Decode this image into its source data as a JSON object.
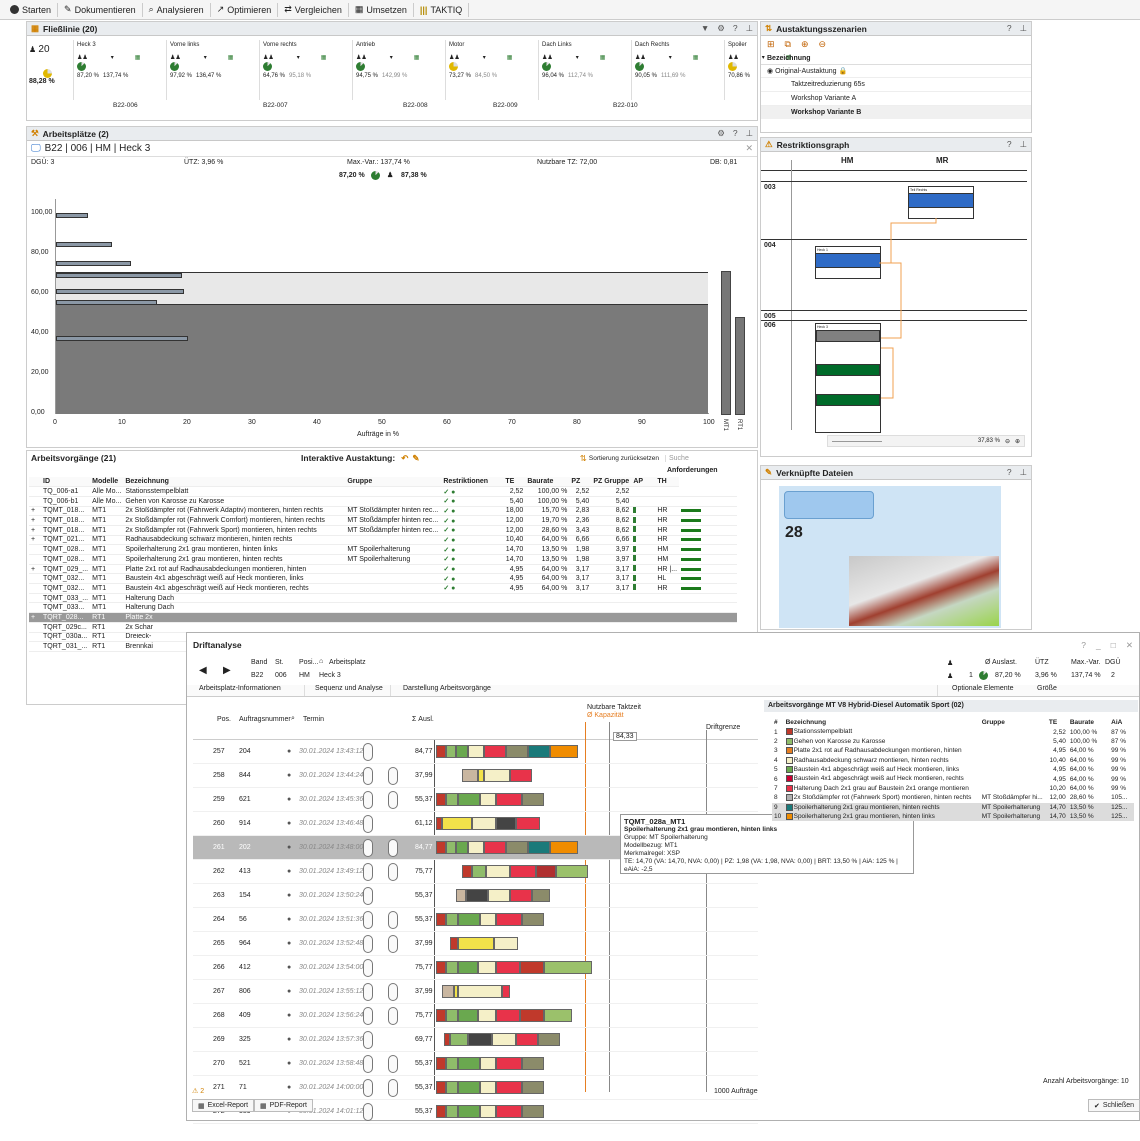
{
  "toolbar": [
    "Starten",
    "Dokumentieren",
    "Analysieren",
    "Optimieren",
    "Vergleichen",
    "Umsetzen",
    "TAKTIQ"
  ],
  "flow": {
    "title": "Fließlinie (20)",
    "count": "20",
    "total": "88,28 %",
    "stations": [
      {
        "name": "Heck 3",
        "a": "87,20 %",
        "b": "137,74 %"
      },
      {
        "name": "Vorne links",
        "a": "97,92 %",
        "b": "136,47 %"
      },
      {
        "name": "Vorne rechts",
        "a": "64,76 %",
        "b": "95,18 %"
      },
      {
        "name": "Antrieb",
        "a": "94,75 %",
        "b": "142,99 %"
      },
      {
        "name": "Motor",
        "a": "73,27 %",
        "b": "84,50 %"
      },
      {
        "name": "Dach Links",
        "a": "96,04 %",
        "b": "112,74 %"
      },
      {
        "name": "Dach Rechts",
        "a": "90,05 %",
        "b": "111,69 %"
      },
      {
        "name": "Spoiler",
        "a": "70,86 %",
        "b": ""
      }
    ],
    "bands": [
      "B22-006",
      "B22-007",
      "B22-008",
      "B22-009",
      "B22-010"
    ]
  },
  "scen": {
    "title": "Austaktungsszenarien",
    "col": "Bezeichnung",
    "items": [
      "Original-Austaktung",
      "Taktzeitreduzierung 65s",
      "Workshop Variante A",
      "Workshop Variante B"
    ]
  },
  "ap": {
    "title": "Arbeitsplätze (2)",
    "name": "B22 | 006 | HM | Heck 3",
    "dgu": "DGÜ: 3",
    "utz": "ÜTZ: 3,96 %",
    "max": "Max.-Var.: 137,74 %",
    "ntz": "Nutzbare TZ: 72,00",
    "db": "DB: 0,81",
    "s1": "87,20 %",
    "s2": "87,38 %",
    "yt": [
      "100,00",
      "80,00",
      "60,00",
      "40,00",
      "20,00",
      "0,00"
    ],
    "xt": [
      "0",
      "10",
      "20",
      "30",
      "40",
      "50",
      "60",
      "70",
      "80",
      "90",
      "100"
    ],
    "xl": "Aufträge in %",
    "vl": [
      "MT1",
      "RT1"
    ]
  },
  "restr": {
    "title": "Restriktionsgraph",
    "c1": "HM",
    "c2": "MR",
    "rows": [
      "003",
      "004",
      "005",
      "006"
    ],
    "lbls": [
      "Teil Rechts",
      "Heck 1",
      "Heck 3"
    ],
    "zoom": "37,83 %"
  },
  "files": {
    "title": "Verknüpfte Dateien",
    "num": "28"
  },
  "av": {
    "title": "Arbeitsvorgänge (21)",
    "ia": "Interaktive Austaktung:",
    "sort": "Sortierung zurücksetzen",
    "search": "Suche",
    "anf": "Anforderungen",
    "cols": [
      "ID",
      "Modelle",
      "Bezeichnung",
      "Gruppe",
      "Restriktionen",
      "TE",
      "Baurate",
      "PZ",
      "PZ Gruppe",
      "AP",
      "TH"
    ],
    "rows": [
      [
        "",
        "TQ_006-a1",
        "Alle Mo...",
        "Stationsstempelblatt",
        "",
        "2,52",
        "100,00 %",
        "2,52",
        "2,52",
        ""
      ],
      [
        "",
        "TQ_006-b1",
        "Alle Mo...",
        "Gehen von Karosse zu Karosse",
        "",
        "5,40",
        "100,00 %",
        "5,40",
        "5,40",
        ""
      ],
      [
        "+",
        "TQMT_018...",
        "MT1",
        "2x Stoßdämpfer rot (Fahrwerk Adaptiv) montieren, hinten rechts",
        "MT Stoßdämpfer hinten rec...",
        "18,00",
        "15,70 %",
        "2,83",
        "8,62",
        "HR"
      ],
      [
        "+",
        "TQMT_018...",
        "MT1",
        "2x Stoßdämpfer rot (Fahrwerk Comfort) montieren, hinten rechts",
        "MT Stoßdämpfer hinten rec...",
        "12,00",
        "19,70 %",
        "2,36",
        "8,62",
        "HR"
      ],
      [
        "+",
        "TQMT_018...",
        "MT1",
        "2x Stoßdämpfer rot (Fahrwerk Sport) montieren, hinten rechts",
        "MT Stoßdämpfer hinten rec...",
        "12,00",
        "28,60 %",
        "3,43",
        "8,62",
        "HR"
      ],
      [
        "+",
        "TQMT_021...",
        "MT1",
        "Radhausabdeckung schwarz montieren, hinten rechts",
        "",
        "10,40",
        "64,00 %",
        "6,66",
        "6,66",
        "HR"
      ],
      [
        "",
        "TQMT_028...",
        "MT1",
        "Spoilerhalterung 2x1 grau montieren, hinten links",
        "MT Spoilerhalterung",
        "14,70",
        "13,50 %",
        "1,98",
        "3,97",
        "HM"
      ],
      [
        "",
        "TQMT_028...",
        "MT1",
        "Spoilerhalterung 2x1 grau montieren, hinten rechts",
        "MT Spoilerhalterung",
        "14,70",
        "13,50 %",
        "1,98",
        "3,97",
        "HM"
      ],
      [
        "+",
        "TQMT_029_...",
        "MT1",
        "Platte 2x1 rot auf Radhausabdeckungen montieren, hinten",
        "",
        "4,95",
        "64,00 %",
        "3,17",
        "3,17",
        "HR |..."
      ],
      [
        "",
        "TQMT_032...",
        "MT1",
        "Baustein 4x1 abgeschrägt weiß auf Heck montieren, links",
        "",
        "4,95",
        "64,00 %",
        "3,17",
        "3,17",
        "HL"
      ],
      [
        "",
        "TQMT_032...",
        "MT1",
        "Baustein 4x1 abgeschrägt weiß auf Heck montieren, rechts",
        "",
        "4,95",
        "64,00 %",
        "3,17",
        "3,17",
        "HR"
      ],
      [
        "",
        "TQMT_033_...",
        "MT1",
        "Halterung Dach",
        "",
        "",
        "",
        "",
        "",
        ""
      ],
      [
        "",
        "TQMT_033...",
        "MT1",
        "Halterung Dach",
        "",
        "",
        "",
        "",
        "",
        ""
      ],
      [
        "+",
        "TQRT_028...",
        "RT1",
        "Platte 2x",
        "",
        "",
        "",
        "",
        "",
        ""
      ],
      [
        "",
        "TQRT_029c...",
        "RT1",
        "2x Schar",
        "",
        "",
        "",
        "",
        "",
        ""
      ],
      [
        "",
        "TQRT_030a...",
        "RT1",
        "Dreieck-",
        "",
        "",
        "",
        "",
        "",
        ""
      ],
      [
        "",
        "TQRT_031_...",
        "RT1",
        "Brennkai",
        "",
        "",
        "",
        "",
        "",
        ""
      ]
    ]
  },
  "drift": {
    "title": "Driftanalyse",
    "band": "Band",
    "st": "St.",
    "posi": "Posi...",
    "arbeitsplatz": "Arbeitsplatz",
    "bv": "B22",
    "sv": "006",
    "pv": "HM",
    "av": "Heck 3",
    "h_ausl": "Ø Auslast.",
    "h_utz": "ÜTZ",
    "h_max": "Max.-Var.",
    "h_dgu": "DGÜ",
    "v_n": "1",
    "v_ausl": "87,20 %",
    "v_utz": "3,96 %",
    "v_max": "137,74 %",
    "v_dgu": "2",
    "tabs": [
      "Arbeitsplatz-Informationen",
      "Sequenz und Analyse",
      "Darstellung Arbeitsvorgänge",
      "Optionale Elemente",
      "Größe"
    ],
    "ch": [
      "Pos.",
      "Auftragsnummer",
      "Termin",
      "Σ Ausl."
    ],
    "ntz": "Nutzbare Taktzeit",
    "kap": "Ø Kapazität",
    "drg": "Driftgrenze",
    "kv": "84,33",
    "rows": [
      [
        "257",
        "204",
        "30.01.2024 13:43:12",
        "84,77"
      ],
      [
        "258",
        "844",
        "30.01.2024 13:44:24",
        "37,99"
      ],
      [
        "259",
        "621",
        "30.01.2024 13:45:36",
        "55,37"
      ],
      [
        "260",
        "914",
        "30.01.2024 13:46:48",
        "61,12"
      ],
      [
        "261",
        "202",
        "30.01.2024 13:48:00",
        "84,77"
      ],
      [
        "262",
        "413",
        "30.01.2024 13:49:12",
        "75,77"
      ],
      [
        "263",
        "154",
        "30.01.2024 13:50:24",
        "55,37"
      ],
      [
        "264",
        "56",
        "30.01.2024 13:51:36",
        "55,37"
      ],
      [
        "265",
        "964",
        "30.01.2024 13:52:48",
        "37,99"
      ],
      [
        "266",
        "412",
        "30.01.2024 13:54:00",
        "75,77"
      ],
      [
        "267",
        "806",
        "30.01.2024 13:55:12",
        "37,99"
      ],
      [
        "268",
        "409",
        "30.01.2024 13:56:24",
        "75,77"
      ],
      [
        "269",
        "325",
        "30.01.2024 13:57:36",
        "69,77"
      ],
      [
        "270",
        "521",
        "30.01.2024 13:58:48",
        "55,37"
      ],
      [
        "271",
        "71",
        "30.01.2024 14:00:00",
        "55,37"
      ],
      [
        "272",
        "589",
        "30.01.2024 14:01:12",
        "55,37"
      ]
    ],
    "tip": [
      "TQMT_028a_MT1",
      "Spoilerhalterung 2x1 grau montieren, hinten links",
      "Gruppe: MT Spoilerhalterung",
      "Modellbezug: MT1",
      "Merkmalregel: XSP",
      "TE: 14,70 (VA: 14,70, NVA: 0,00) | PZ: 1,98 (VA: 1,98, NVA: 0,00) | BRT: 13,50 % | AiA: 125 % | eAiA: -2,5"
    ],
    "foot": "1000 Aufträge",
    "warn": "2",
    "excel": "Excel-Report",
    "pdf": "PDF-Report",
    "close": "Schließen"
  },
  "rp": {
    "title": "Arbeitsvorgänge MT V8 Hybrid-Diesel Automatik Sport (02)",
    "cols": [
      "#",
      "Bezeichnung",
      "Gruppe",
      "TE",
      "Baurate",
      "AiA"
    ],
    "rows": [
      [
        "1",
        "Stationsstempelblatt",
        "",
        "2,52",
        "100,00 %",
        "87 %",
        "#c0392b"
      ],
      [
        "2",
        "Gehen von Karosse zu Karosse",
        "",
        "5,40",
        "100,00 %",
        "87 %",
        "#8fbc6a"
      ],
      [
        "3",
        "Platte 2x1 rot auf Radhausabdeckungen montieren, hinten",
        "",
        "4,95",
        "64,00 %",
        "99 %",
        "#e67e22"
      ],
      [
        "4",
        "Radhausabdeckung schwarz montieren, hinten rechts",
        "",
        "10,40",
        "64,00 %",
        "99 %",
        "#f5f0c8"
      ],
      [
        "5",
        "Baustein 4x1 abgeschrägt weiß auf Heck montieren, links",
        "",
        "4,95",
        "64,00 %",
        "99 %",
        "#6aa84f"
      ],
      [
        "6",
        "Baustein 4x1 abgeschrägt weiß auf Heck montieren, rechts",
        "",
        "4,95",
        "64,00 %",
        "99 %",
        "#cc0033"
      ],
      [
        "7",
        "Halterung Dach 2x1 grau auf Baustein 2x1 orange montieren",
        "",
        "10,20",
        "64,00 %",
        "99 %",
        "#e8334a"
      ],
      [
        "8",
        "2x Stoßdämpfer rot (Fahrwerk Sport) montieren, hinten rechts",
        "MT Stoßdämpfer hi...",
        "12,00",
        "28,60 %",
        "105...",
        "#b0b0b0"
      ],
      [
        "9",
        "Spoilerhalterung 2x1 grau montieren, hinten rechts",
        "MT Spoilerhalterung",
        "14,70",
        "13,50 %",
        "125...",
        "#1a7a7a"
      ],
      [
        "10",
        "Spoilerhalterung 2x1 grau montieren, hinten links",
        "MT Spoilerhalterung",
        "14,70",
        "13,50 %",
        "125...",
        "#f08c00"
      ]
    ],
    "foot": "Anzahl Arbeitsvorgänge: 10"
  }
}
